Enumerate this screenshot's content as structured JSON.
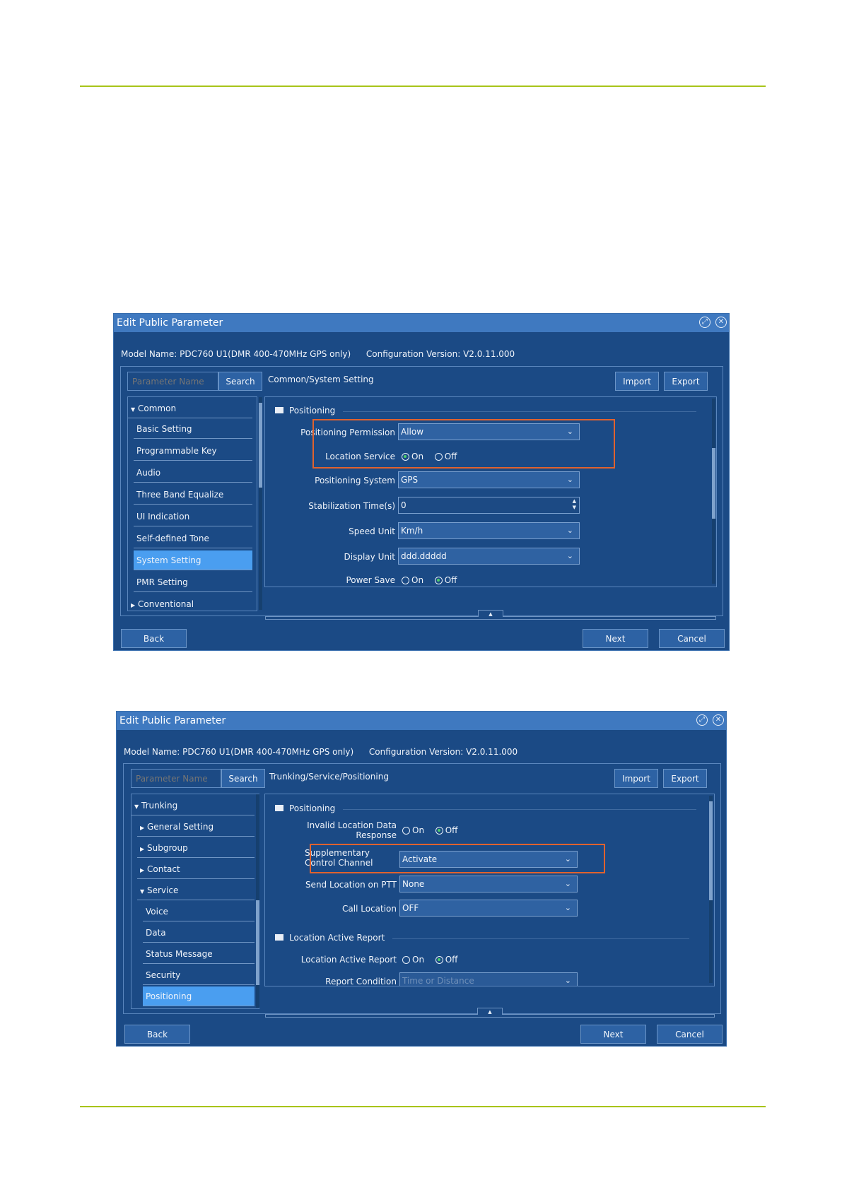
{
  "window1": {
    "title": "Edit Public Parameter",
    "model_label": "Model Name:",
    "model_value": "PDC760 U1(DMR 400-470MHz GPS only)",
    "config_label": "Configuration Version:",
    "config_value": "V2.0.11.000",
    "search_placeholder": "Parameter Name",
    "search_label": "Search",
    "breadcrumb": "Common/System Setting",
    "import_label": "Import",
    "export_label": "Export",
    "nav": [
      {
        "label": "Common",
        "arrow": "▼"
      },
      {
        "label": "Basic Setting"
      },
      {
        "label": "Programmable Key"
      },
      {
        "label": "Audio"
      },
      {
        "label": "Three Band Equalize"
      },
      {
        "label": "UI Indication"
      },
      {
        "label": "Self-defined Tone"
      },
      {
        "label": "System Setting",
        "selected": true
      },
      {
        "label": "PMR Setting"
      },
      {
        "label": "Conventional",
        "arrow": "▶"
      }
    ],
    "section_title": "Positioning",
    "fields": [
      {
        "label": "Positioning Permission",
        "value": "Allow"
      },
      {
        "label": "Location Service",
        "on": "On",
        "off": "Off",
        "selected": "On"
      },
      {
        "label": "Positioning System",
        "value": "GPS"
      },
      {
        "label": "Stabilization Time(s)",
        "value": "0"
      },
      {
        "label": "Speed Unit",
        "value": "Km/h"
      },
      {
        "label": "Display Unit",
        "value": "ddd.ddddd"
      },
      {
        "label": "Power Save",
        "on": "On",
        "off": "Off",
        "selected": "Off"
      }
    ],
    "back_label": "Back",
    "next_label": "Next",
    "cancel_label": "Cancel"
  },
  "window2": {
    "title": "Edit Public Parameter",
    "model_label": "Model Name:",
    "model_value": "PDC760 U1(DMR 400-470MHz GPS only)",
    "config_label": "Configuration Version:",
    "config_value": "V2.0.11.000",
    "search_placeholder": "Parameter Name",
    "search_label": "Search",
    "breadcrumb": "Trunking/Service/Positioning",
    "import_label": "Import",
    "export_label": "Export",
    "nav": [
      {
        "label": "Trunking",
        "arrow": "▼"
      },
      {
        "label": "General Setting",
        "arrow": "▶"
      },
      {
        "label": "Subgroup",
        "arrow": "▶"
      },
      {
        "label": "Contact",
        "arrow": "▶"
      },
      {
        "label": "Service",
        "arrow": "▼"
      },
      {
        "label": "Voice"
      },
      {
        "label": "Data"
      },
      {
        "label": "Status Message"
      },
      {
        "label": "Security"
      },
      {
        "label": "Positioning",
        "selected": true
      }
    ],
    "section1_title": "Positioning",
    "section2_title": "Location Active Report",
    "fields": [
      {
        "label": "Invalid Location Data Response",
        "on": "On",
        "off": "Off",
        "selected": "Off"
      },
      {
        "label": "Supplementary Control Channel",
        "value": "Activate"
      },
      {
        "label": "Send Location on PTT",
        "value": "None"
      },
      {
        "label": "Call Location",
        "value": "OFF"
      },
      {
        "label": "Location Active Report",
        "on": "On",
        "off": "Off",
        "selected": "Off"
      },
      {
        "label": "Report Condition",
        "value": "Time or Distance"
      }
    ],
    "back_label": "Back",
    "next_label": "Next",
    "cancel_label": "Cancel"
  }
}
